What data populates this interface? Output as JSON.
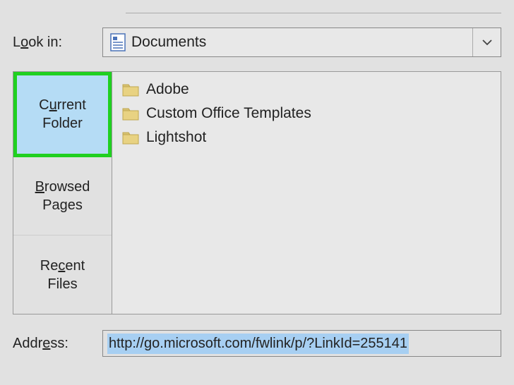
{
  "lookin": {
    "label_pre": "L",
    "label_u": "o",
    "label_post": "ok in:",
    "value": "Documents"
  },
  "tabs": {
    "current": {
      "line1_pre": "C",
      "line1_u": "u",
      "line1_post": "rrent",
      "line2": "Folder"
    },
    "browsed": {
      "line1_u": "B",
      "line1_post": "rowsed",
      "line2": "Pages"
    },
    "recent": {
      "line1_pre": "Re",
      "line1_u": "c",
      "line1_post": "ent",
      "line2": "Files"
    }
  },
  "items": [
    {
      "name": "Adobe"
    },
    {
      "name": "Custom Office Templates"
    },
    {
      "name": "Lightshot"
    }
  ],
  "address": {
    "label_pre": "Addr",
    "label_u": "e",
    "label_post": "ss:",
    "value": "http://go.microsoft.com/fwlink/p/?LinkId=255141"
  }
}
